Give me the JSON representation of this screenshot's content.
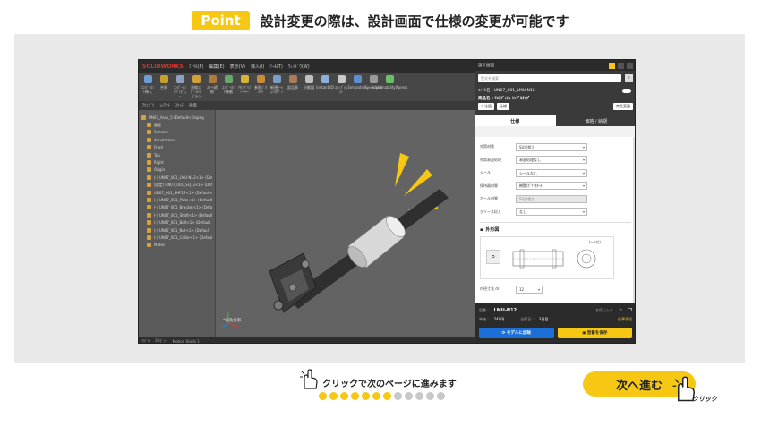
{
  "header": {
    "badge": "Point",
    "title": "設計変更の際は、設計画面で仕様の変更が可能です"
  },
  "cad": {
    "app_name": "SOLIDWORKS",
    "menu": [
      "ﾌｧｲﾙ(F)",
      "編集(E)",
      "表示(V)",
      "挿入(I)",
      "ﾂｰﾙ(T)",
      "ｳｨﾝﾄﾞｳ(W)"
    ],
    "ribbon": [
      {
        "label": "ｺﾝﾎﾟｰﾈﾝﾄ挿入",
        "color": "#6d9ed8"
      },
      {
        "label": "合致",
        "color": "#c9a12a"
      },
      {
        "label": "ｺﾝﾎﾟｰﾈﾝﾄﾌﾟﾚﾋﾞｭｰ",
        "color": "#8aa1c1"
      },
      {
        "label": "直線ｺﾝﾎﾟｰﾈﾝﾄﾊﾟﾀｰﾝ",
        "color": "#d0a03a"
      },
      {
        "label": "ｽﾏｰﾄ締結",
        "color": "#b07a3a"
      },
      {
        "label": "ｺﾝﾎﾟｰﾈﾝﾄ移動",
        "color": "#6aa86a"
      },
      {
        "label": "ｱｾﾝﾌﾞﾘﾌｨｰﾁｬｰ",
        "color": "#d6b43a"
      },
      {
        "label": "参照ｼﾞｵﾒﾄﾘ",
        "color": "#c98a3a"
      },
      {
        "label": "新規ﾓｰｼｮﾝｽﾀﾃﾞｨ",
        "color": "#7aa0c8"
      },
      {
        "label": "部品表",
        "color": "#aa7a5a"
      },
      {
        "label": "分解図",
        "color": "#c0c0c0"
      },
      {
        "label": "Instant3D",
        "color": "#8ab0d8"
      },
      {
        "label": "ｽﾅｯﾌﾟｼｮｯﾄ",
        "color": "#c8c8c8"
      },
      {
        "label": "Simulation",
        "color": "#5b8fd0"
      },
      {
        "label": "Speedpak",
        "color": "#9a9a9a"
      },
      {
        "label": "SustainabilityXpress",
        "color": "#6abf6a"
      }
    ],
    "tabs": [
      "ｱｾﾝﾌﾞﾘ",
      "ﾚｲｱｳﾄ",
      "ｽｹｯﾁ",
      "評価"
    ],
    "tree": [
      "UN07_Assy_5 (Default<Display",
      "履歴",
      "Sensors",
      "Annotations",
      "Front",
      "Top",
      "Right",
      "Origin",
      "(-) UN07_001_LMU-N12<1> (Default",
      "(固定) UN07_001_SFJ12<1> (Default",
      "UN07_001_SHF12<1> (Default<<D",
      "(-) UN07_001_Plate<1> (Default",
      "(-) UN07_001_Bracket<1> (Default",
      "(-) UN07_001_Shaft<1> (Default",
      "(-) UN07_001_Bolt<1> (Default",
      "(-) UN07_001_Nut<1> (Default",
      "(-) UN07_001_Collar<1> (Default",
      "Mates"
    ],
    "view_label": "*等角投影",
    "status": [
      "ﾓﾃﾞﾙ",
      "3Dﾋﾞｭｰ",
      "Motion Study 1"
    ]
  },
  "panel": {
    "title": "設計画面",
    "search_placeholder": "型式を検索",
    "file_label": "ﾌｧｲﾙ名 : UN07_001_LMU-N12",
    "part_name": "商品名 : ﾘﾆｱﾌﾞｯｼｭ ｼﾝｸﾞﾙﾀｲﾌﾟ",
    "chips": [
      "寸法図",
      "仕様",
      "商品変更"
    ],
    "tab_spec": "仕様",
    "tab_price": "価格 / 納期",
    "specs": [
      {
        "label": "外筒材質",
        "value": "SUJ2相当",
        "disabled": false
      },
      {
        "label": "外筒表面処理",
        "value": "表面処理なし",
        "disabled": false
      },
      {
        "label": "シール",
        "value": "シールなし",
        "disabled": false
      },
      {
        "label": "保持器材質",
        "value": "樹脂(ﾎﾟﾘｱｾﾀｰﾙ)",
        "disabled": false
      },
      {
        "label": "ボール材質",
        "value": "SUJ2相当",
        "disabled": true
      },
      {
        "label": "グリース封入",
        "value": "なし",
        "disabled": false
      }
    ],
    "drawing_title": "外形図",
    "drawing_note": "(ｼｰﾙ付)",
    "extra_row": {
      "label": "内径寸法 dr",
      "value": "12"
    },
    "footer": {
      "model_key": "型番 :",
      "model": "LMU-N12",
      "fav": "お気に入り",
      "price_key": "単価 :",
      "price": "240円",
      "lead_key": "出荷日 :",
      "lead": "3日目",
      "stock": "在庫状況",
      "btn_model": "モデルに反映",
      "btn_save": "型番を保存"
    }
  },
  "nav": {
    "hint": "クリックで次のページに進みます",
    "dots_total": 12,
    "dots_done": 7,
    "next_label": "次へ進む",
    "click_label": "クリック"
  },
  "colors": {
    "accent": "#f6c813",
    "dot_off": "#c8c8c8",
    "stage": "#e9e9e9"
  }
}
